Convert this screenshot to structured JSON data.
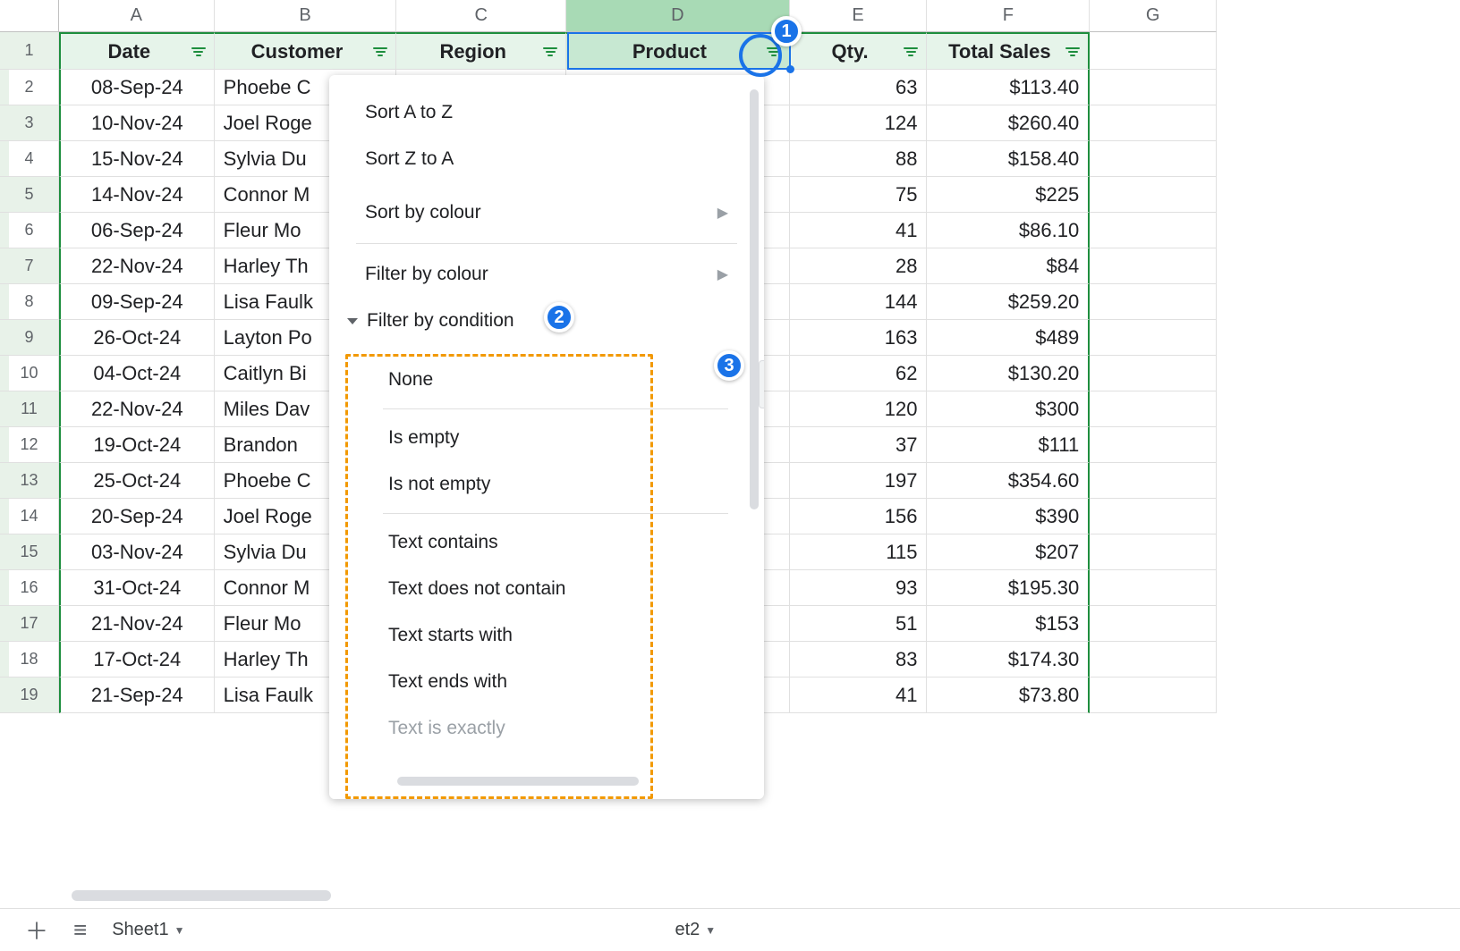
{
  "columns": [
    "A",
    "B",
    "C",
    "D",
    "E",
    "F",
    "G"
  ],
  "headers": {
    "A": "Date",
    "B": "Customer",
    "C": "Region",
    "D": "Product",
    "E": "Qty.",
    "F": "Total Sales"
  },
  "rows": [
    {
      "n": 2,
      "date": "08-Sep-24",
      "customer": "Phoebe C",
      "qty": "63",
      "total": "$113.40"
    },
    {
      "n": 3,
      "date": "10-Nov-24",
      "customer": "Joel Roge",
      "qty": "124",
      "total": "$260.40"
    },
    {
      "n": 4,
      "date": "15-Nov-24",
      "customer": "Sylvia Du",
      "qty": "88",
      "total": "$158.40"
    },
    {
      "n": 5,
      "date": "14-Nov-24",
      "customer": "Connor M",
      "qty": "75",
      "total": "$225"
    },
    {
      "n": 6,
      "date": "06-Sep-24",
      "customer": "Fleur Mo",
      "qty": "41",
      "total": "$86.10"
    },
    {
      "n": 7,
      "date": "22-Nov-24",
      "customer": "Harley Th",
      "qty": "28",
      "total": "$84"
    },
    {
      "n": 8,
      "date": "09-Sep-24",
      "customer": "Lisa Faulk",
      "qty": "144",
      "total": "$259.20"
    },
    {
      "n": 9,
      "date": "26-Oct-24",
      "customer": "Layton Po",
      "qty": "163",
      "total": "$489"
    },
    {
      "n": 10,
      "date": "04-Oct-24",
      "customer": "Caitlyn Bi",
      "qty": "62",
      "total": "$130.20"
    },
    {
      "n": 11,
      "date": "22-Nov-24",
      "customer": "Miles Dav",
      "qty": "120",
      "total": "$300"
    },
    {
      "n": 12,
      "date": "19-Oct-24",
      "customer": "Brandon",
      "qty": "37",
      "total": "$111"
    },
    {
      "n": 13,
      "date": "25-Oct-24",
      "customer": "Phoebe C",
      "qty": "197",
      "total": "$354.60"
    },
    {
      "n": 14,
      "date": "20-Sep-24",
      "customer": "Joel Roge",
      "qty": "156",
      "total": "$390"
    },
    {
      "n": 15,
      "date": "03-Nov-24",
      "customer": "Sylvia Du",
      "qty": "115",
      "total": "$207"
    },
    {
      "n": 16,
      "date": "31-Oct-24",
      "customer": "Connor M",
      "qty": "93",
      "total": "$195.30"
    },
    {
      "n": 17,
      "date": "21-Nov-24",
      "customer": "Fleur Mo",
      "qty": "51",
      "total": "$153"
    },
    {
      "n": 18,
      "date": "17-Oct-24",
      "customer": "Harley Th",
      "qty": "83",
      "total": "$174.30"
    },
    {
      "n": 19,
      "date": "21-Sep-24",
      "customer": "Lisa Faulk",
      "qty": "41",
      "total": "$73.80"
    }
  ],
  "filter_menu": {
    "sort_az": "Sort A to Z",
    "sort_za": "Sort Z to A",
    "sort_by_colour": "Sort by colour",
    "filter_by_colour": "Filter by colour",
    "filter_by_condition": "Filter by condition",
    "conditions": {
      "none": "None",
      "is_empty": "Is empty",
      "is_not_empty": "Is not empty",
      "text_contains": "Text contains",
      "text_not_contain": "Text does not contain",
      "text_starts": "Text starts with",
      "text_ends": "Text ends with",
      "text_exact": "Text is exactly"
    }
  },
  "tabs": {
    "sheet1": "Sheet1",
    "sheet2_partial": "et2"
  },
  "callouts": {
    "c1": "1",
    "c2": "2",
    "c3": "3"
  }
}
